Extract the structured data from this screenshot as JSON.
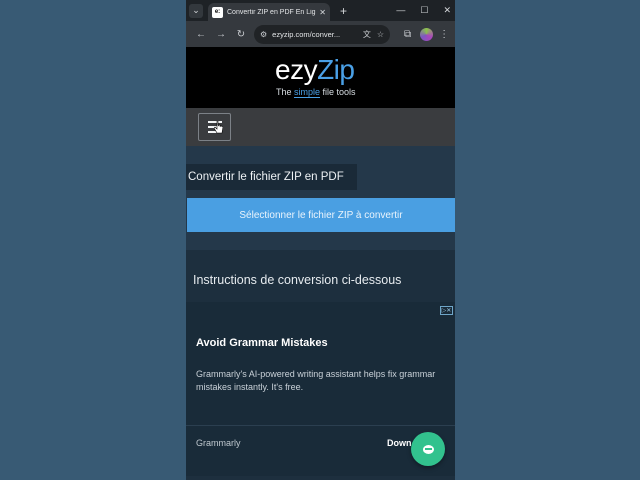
{
  "browser": {
    "tab_title": "Convertir ZIP en PDF En Ligne |",
    "favicon_text": "e:",
    "url": "ezyzip.com/conver..."
  },
  "site": {
    "logo_part1": "ezy",
    "logo_part2": "Zip",
    "tagline_before": "The ",
    "tagline_simple": "simple",
    "tagline_after": " file tools",
    "page_title": "Convertir le fichier ZIP en PDF",
    "select_button": "Sélectionner le fichier ZIP à convertir",
    "instructions_heading": "Instructions de conversion ci-dessous"
  },
  "ad": {
    "title": "Avoid Grammar Mistakes",
    "description": "Grammarly's AI-powered writing assistant helps fix grammar mistakes instantly. It's free.",
    "brand": "Grammarly",
    "cta": "Down"
  },
  "colors": {
    "accent": "#4a9fe2",
    "background": "#375872",
    "fab": "#32c28e"
  },
  "icons": {
    "back": "arrow-left-icon",
    "forward": "arrow-right-icon",
    "reload": "reload-icon",
    "menu": "hamburger-menu-icon",
    "chat": "chat-bubble-icon"
  }
}
